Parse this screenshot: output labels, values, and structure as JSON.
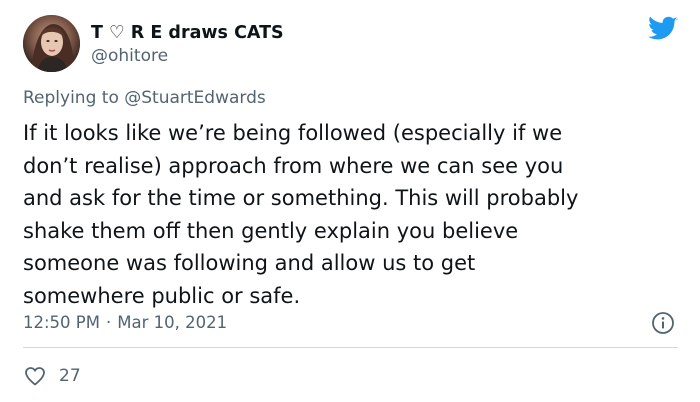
{
  "author": {
    "display_name": "T ♡ R E draws CATS",
    "handle": "@ohitore"
  },
  "reply": {
    "prefix": "Replying to ",
    "mention": "@StuartEdwards"
  },
  "tweet": {
    "lines": [
      "If it looks like we’re being followed (especially if we",
      "don’t realise) approach from where we can see you",
      "and ask for the time or something. This will probably",
      "shake them off then gently explain you believe",
      "someone was following and allow us to get",
      "somewhere public or safe."
    ]
  },
  "meta": {
    "time": "12:50 PM",
    "separator": "·",
    "date": "Mar 10, 2021"
  },
  "stats": {
    "likes": "27"
  },
  "colors": {
    "brand": "#1d9bf0",
    "text": "#0f1419",
    "secondary": "#536471",
    "divider": "#cfd9de"
  },
  "icons": {
    "brand": "twitter-bird-icon",
    "info": "info-icon",
    "like": "heart-icon"
  }
}
